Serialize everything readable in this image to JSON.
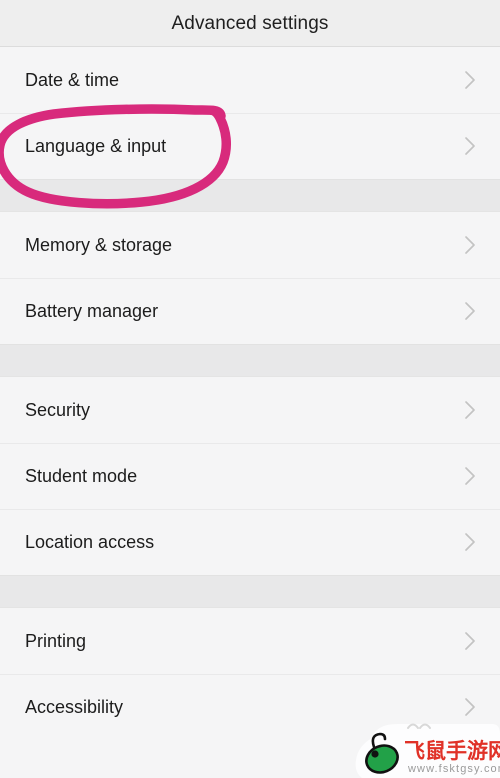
{
  "header": {
    "title": "Advanced settings"
  },
  "list": {
    "sections": [
      {
        "id": "section-1",
        "rows": [
          {
            "label": "Date & time",
            "chevron": "chevron-right-icon"
          },
          {
            "label": "Language & input",
            "chevron": "chevron-right-icon"
          }
        ]
      },
      {
        "id": "section-2",
        "rows": [
          {
            "label": "Memory & storage",
            "chevron": "chevron-right-icon"
          },
          {
            "label": "Battery manager",
            "chevron": "chevron-right-icon"
          }
        ]
      },
      {
        "id": "section-3",
        "rows": [
          {
            "label": "Security",
            "chevron": "chevron-right-icon"
          },
          {
            "label": "Student mode",
            "chevron": "chevron-right-icon"
          },
          {
            "label": "Location access",
            "chevron": "chevron-right-icon"
          }
        ]
      },
      {
        "id": "section-4",
        "rows": [
          {
            "label": "Printing",
            "chevron": "chevron-right-icon"
          },
          {
            "label": "Accessibility",
            "chevron": "chevron-right-icon"
          }
        ]
      }
    ]
  },
  "annotation": {
    "type": "hand-drawn-ellipse",
    "target_label": "Language & input",
    "color": "#d82a7c"
  },
  "watermark": {
    "site_name": "飞鼠手游网",
    "url": "www.fsktgsy.com",
    "logo": "mouse-logo-icon",
    "logo_color": "#22a148",
    "text_color": "#e03127"
  },
  "colors": {
    "header_bg": "#eeeeee",
    "row_bg": "#f5f5f6",
    "gap_bg": "#e8e8e9",
    "divider": "#e9e9ea",
    "text": "#1c1c1c",
    "chevron": "#c3c3c3",
    "accent_pink": "#d82a7c"
  }
}
